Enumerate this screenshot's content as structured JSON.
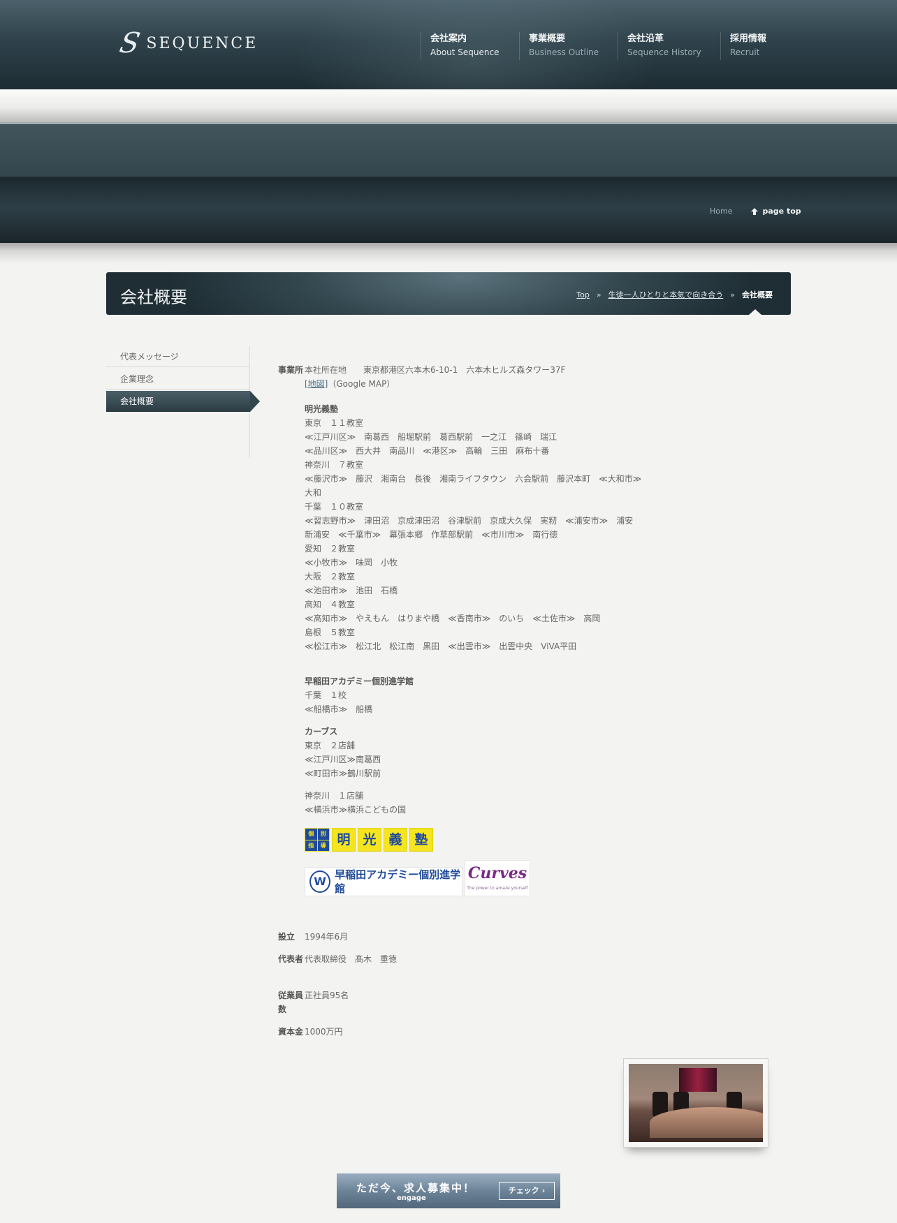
{
  "header": {
    "logo_mark": "S",
    "logo_text": "SEQUENCE",
    "nav": [
      {
        "jp": "会社案内",
        "en": "About Sequence"
      },
      {
        "jp": "事業概要",
        "en": "Business Outline"
      },
      {
        "jp": "会社沿革",
        "en": "Sequence History"
      },
      {
        "jp": "採用情報",
        "en": "Recruit"
      }
    ]
  },
  "utility": {
    "home": "Home",
    "pagetop": "page top"
  },
  "titlebar": {
    "title": "会社概要",
    "breadcrumb": [
      "Top",
      "生徒一人ひとりと本気で向き合う",
      "会社概要"
    ],
    "separator": "»"
  },
  "sidebar": {
    "items": [
      "代表メッセージ",
      "企業理念",
      "会社概要"
    ]
  },
  "info": {
    "office": {
      "label": "事業所",
      "hq": "本社所在地　　東京都港区六本木6-10-1　六本木ヒルズ森タワー37F",
      "map_link": "[地図]",
      "map_suffix": "（Google MAP）",
      "meiko_title": "明光義塾",
      "meiko_lines": [
        "東京　１１教室",
        "≪江戸川区≫　南葛西　船堀駅前　葛西駅前　一之江　篠崎　瑞江",
        "≪品川区≫　西大井　南品川　≪港区≫　高輪　三田　麻布十番",
        "神奈川　７教室",
        "≪藤沢市≫　藤沢　湘南台　長後　湘南ライフタウン　六会駅前　藤沢本町　≪大和市≫",
        "大和",
        "千葉　１０教室",
        "≪習志野市≫　津田沼　京成津田沼　谷津駅前　京成大久保　実籾　≪浦安市≫　浦安",
        "新浦安　≪千葉市≫　幕張本郷　作草部駅前　≪市川市≫　南行徳",
        "愛知　２教室",
        "≪小牧市≫　味岡　小牧",
        "大阪　２教室",
        "≪池田市≫　池田　石橋",
        "高知　４教室",
        "≪高知市≫　やえもん　はりまや橋　≪香南市≫　のいち　≪土佐市≫　高岡",
        "島根　５教室",
        "≪松江市≫　松江北　松江南　黒田　≪出雲市≫　出雲中央　ViVA平田"
      ],
      "waseda_title": "早稲田アカデミー個別進学館",
      "waseda_lines": [
        "千葉　１校",
        "≪船橋市≫　船橋"
      ],
      "curves_title": "カーブス",
      "curves_lines": [
        "東京　２店舗",
        "≪江戸川区≫南葛西",
        "≪町田市≫鶴川駅前"
      ],
      "curves_lines2": [
        "神奈川　１店舗",
        "≪横浜市≫横浜こどもの国"
      ],
      "logos": {
        "meiko_small": [
          "個",
          "別",
          "指",
          "導"
        ],
        "meiko_big": [
          "明",
          "光",
          "義",
          "塾"
        ],
        "waseda_mark": "W",
        "waseda_text": "早稲田アカデミー個別進学館",
        "curves_text": "Curves",
        "curves_tag": "The power to amaze yourself"
      }
    },
    "founded": {
      "label": "設立",
      "value": "1994年6月"
    },
    "rep": {
      "label": "代表者",
      "value": "代表取締役　髙木　重徳"
    },
    "employees": {
      "label": "従業員数",
      "value": "正社員95名"
    },
    "capital": {
      "label": "資本金",
      "value": "1000万円"
    }
  },
  "banner": {
    "main": "ただ今、求人募集中！",
    "sub": "engage",
    "button": "チェック ›"
  }
}
